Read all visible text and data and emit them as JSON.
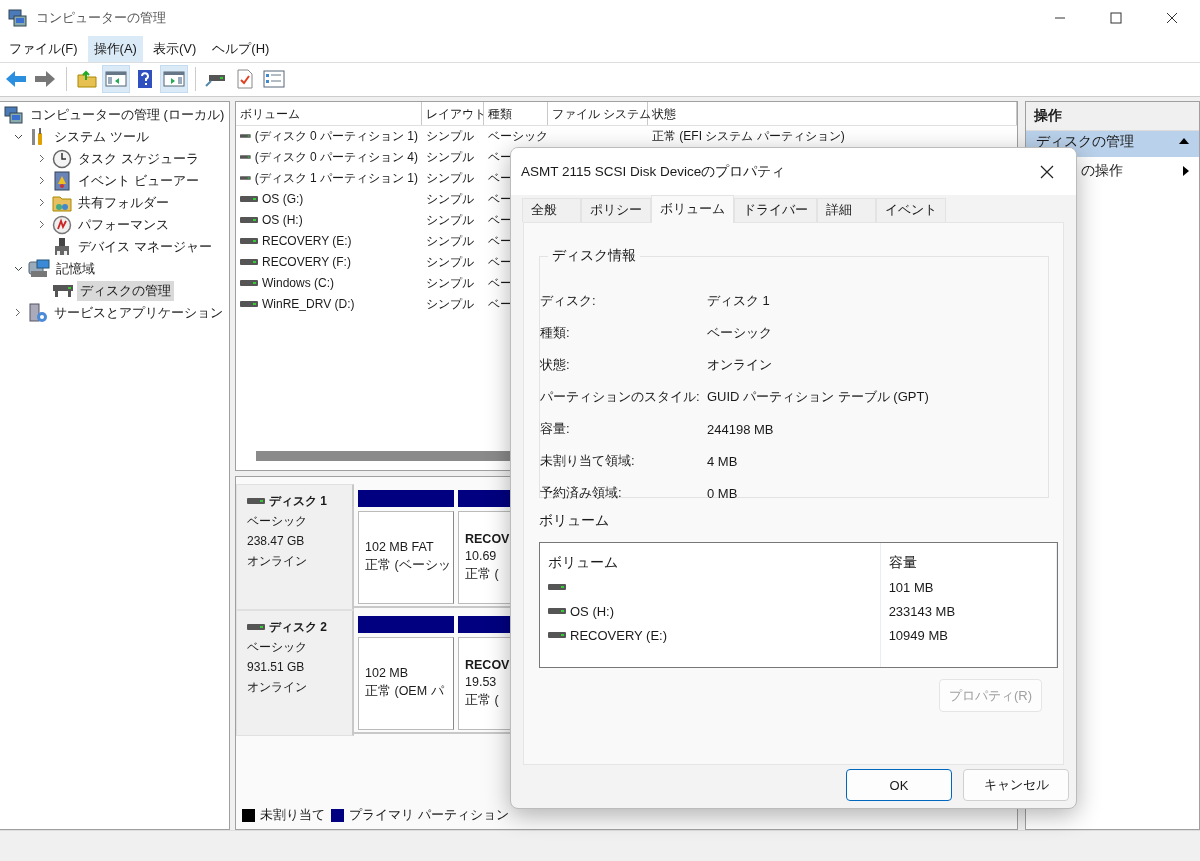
{
  "window": {
    "title": "コンピューターの管理"
  },
  "menu": [
    {
      "label": "ファイル(F)",
      "selected": false
    },
    {
      "label": "操作(A)",
      "selected": true
    },
    {
      "label": "表示(V)",
      "selected": false
    },
    {
      "label": "ヘルプ(H)",
      "selected": false
    }
  ],
  "toolbar": [
    {
      "pressed": false
    },
    {
      "pressed": false
    },
    {
      "pressed": false
    },
    {
      "pressed": true
    },
    {
      "pressed": false
    },
    {
      "pressed": true
    },
    {
      "pressed": false
    },
    {
      "pressed": false
    },
    {
      "pressed": false
    }
  ],
  "tree": [
    {
      "label": "コンピューターの管理 (ローカル)",
      "selected": false,
      "children": [
        {
          "label": "システム ツール",
          "expanded": true,
          "selected": false,
          "children": [
            {
              "label": "タスク スケジューラ",
              "expanded": false,
              "selected": false
            },
            {
              "label": "イベント ビューアー",
              "expanded": false,
              "selected": false
            },
            {
              "label": "共有フォルダー",
              "expanded": false,
              "selected": false
            },
            {
              "label": "パフォーマンス",
              "expanded": false,
              "selected": false
            },
            {
              "label": "デバイス マネージャー",
              "selected": false
            }
          ]
        },
        {
          "label": "記憶域",
          "expanded": true,
          "selected": false,
          "children": [
            {
              "label": "ディスクの管理",
              "selected": true
            }
          ]
        },
        {
          "label": "サービスとアプリケーション",
          "expanded": false,
          "selected": false
        }
      ]
    }
  ],
  "volume_list": {
    "columns": [
      "ボリューム",
      "レイアウト",
      "種類",
      "ファイル システム",
      "状態"
    ],
    "rows": [
      {
        "name": "(ディスク 0 パーティション 1)",
        "layout": "シンプル",
        "type": "ベーシック",
        "status": "正常 (EFI システム パーティション)"
      },
      {
        "name": "(ディスク 0 パーティション 4)",
        "layout": "シンプル",
        "type": "ベー"
      },
      {
        "name": "(ディスク 1 パーティション 1)",
        "layout": "シンプル",
        "type": "ベー"
      },
      {
        "name": "OS (G:)",
        "layout": "シンプル",
        "type": "ベー"
      },
      {
        "name": "OS (H:)",
        "layout": "シンプル",
        "type": "ベー"
      },
      {
        "name": "RECOVERY (E:)",
        "layout": "シンプル",
        "type": "ベー"
      },
      {
        "name": "RECOVERY (F:)",
        "layout": "シンプル",
        "type": "ベー"
      },
      {
        "name": "Windows (C:)",
        "layout": "シンプル",
        "type": "ベー"
      },
      {
        "name": "WinRE_DRV (D:)",
        "layout": "シンプル",
        "type": "ベー"
      }
    ]
  },
  "disks": [
    {
      "name": "ディスク 1",
      "type": "ベーシック",
      "size": "238.47 GB",
      "status": "オンライン",
      "partitions": [
        {
          "color": "#000080",
          "lines": [
            "102 MB FAT",
            "正常 (ベーシッ"
          ]
        },
        {
          "color": "#000080",
          "title": "RECOV",
          "lines": [
            "10.69",
            "正常 ("
          ]
        }
      ]
    },
    {
      "name": "ディスク 2",
      "type": "ベーシック",
      "size": "931.51 GB",
      "status": "オンライン",
      "partitions": [
        {
          "color": "#000080",
          "lines": [
            "102 MB",
            "正常 (OEM パ"
          ]
        },
        {
          "color": "#000080",
          "title": "RECOV",
          "lines": [
            "19.53",
            "正常 ("
          ]
        }
      ]
    }
  ],
  "legend": [
    {
      "label": "未割り当て",
      "color": "#000000"
    },
    {
      "label": "プライマリ パーティション",
      "color": "#000080"
    }
  ],
  "actions": {
    "title": "操作",
    "items": [
      {
        "label": "ディスクの管理",
        "kind": "header"
      },
      {
        "label": "の操作",
        "kind": "submenu"
      }
    ]
  },
  "dialog": {
    "title": "ASMT 2115 SCSI Disk Deviceのプロパティ",
    "tabs": [
      {
        "label": "全般",
        "selected": false
      },
      {
        "label": "ポリシー",
        "selected": false
      },
      {
        "label": "ボリューム",
        "selected": true
      },
      {
        "label": "ドライバー",
        "selected": false
      },
      {
        "label": "詳細",
        "selected": false
      },
      {
        "label": "イベント",
        "selected": false
      }
    ],
    "group_title": "ディスク情報",
    "fields": [
      {
        "label": "ディスク:",
        "value": "ディスク 1"
      },
      {
        "label": "種類:",
        "value": "ベーシック"
      },
      {
        "label": "状態:",
        "value": "オンライン"
      },
      {
        "label": "パーティションのスタイル:",
        "value": "GUID パーティション テーブル (GPT)"
      },
      {
        "label": "容量:",
        "value": "244198 MB"
      },
      {
        "label": "未割り当て領域:",
        "value": "4 MB"
      },
      {
        "label": "予約済み領域:",
        "value": "0 MB"
      }
    ],
    "volumes_label": "ボリューム",
    "volumes": {
      "columns": [
        "ボリューム",
        "容量"
      ],
      "rows": [
        {
          "capacity": "101 MB"
        },
        {
          "name": "OS (H:)",
          "capacity": "233143 MB"
        },
        {
          "name": "RECOVERY (E:)",
          "capacity": "10949 MB"
        }
      ]
    },
    "properties_button": {
      "label": "プロパティ(R)",
      "disabled": true
    },
    "buttons": [
      {
        "label": "OK",
        "default": true
      },
      {
        "label": "キャンセル",
        "default": false
      }
    ]
  }
}
